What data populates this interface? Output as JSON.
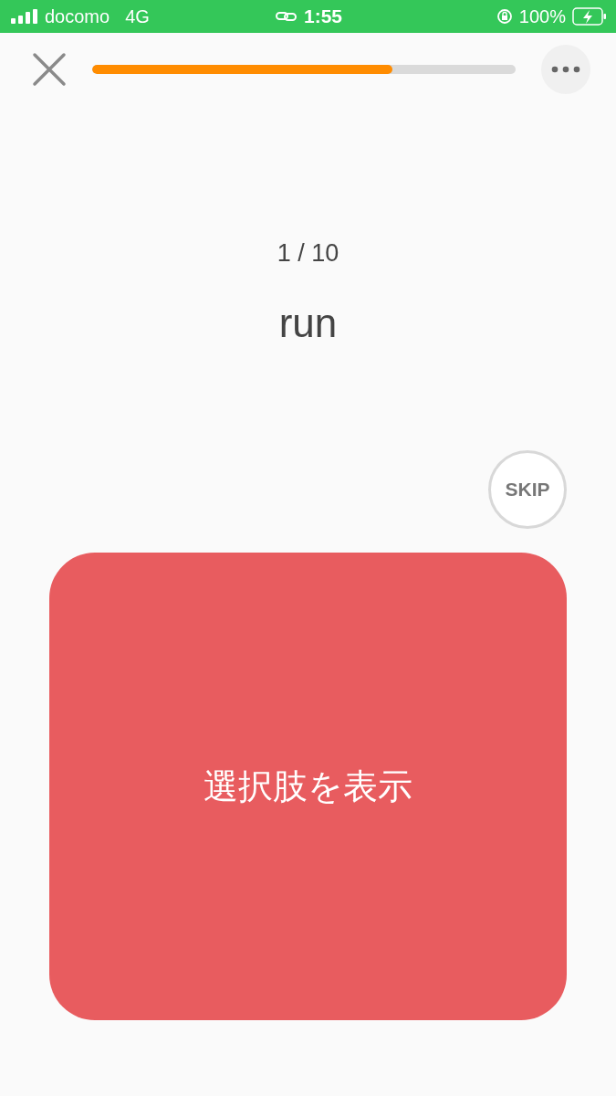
{
  "status_bar": {
    "carrier": "docomo",
    "network": "4G",
    "time": "1:55",
    "battery": "100%"
  },
  "progress": {
    "level": 0.71
  },
  "counter": "1 / 10",
  "word": "run",
  "skip_button": "SKIP",
  "reveal_button": "選択肢を表示"
}
